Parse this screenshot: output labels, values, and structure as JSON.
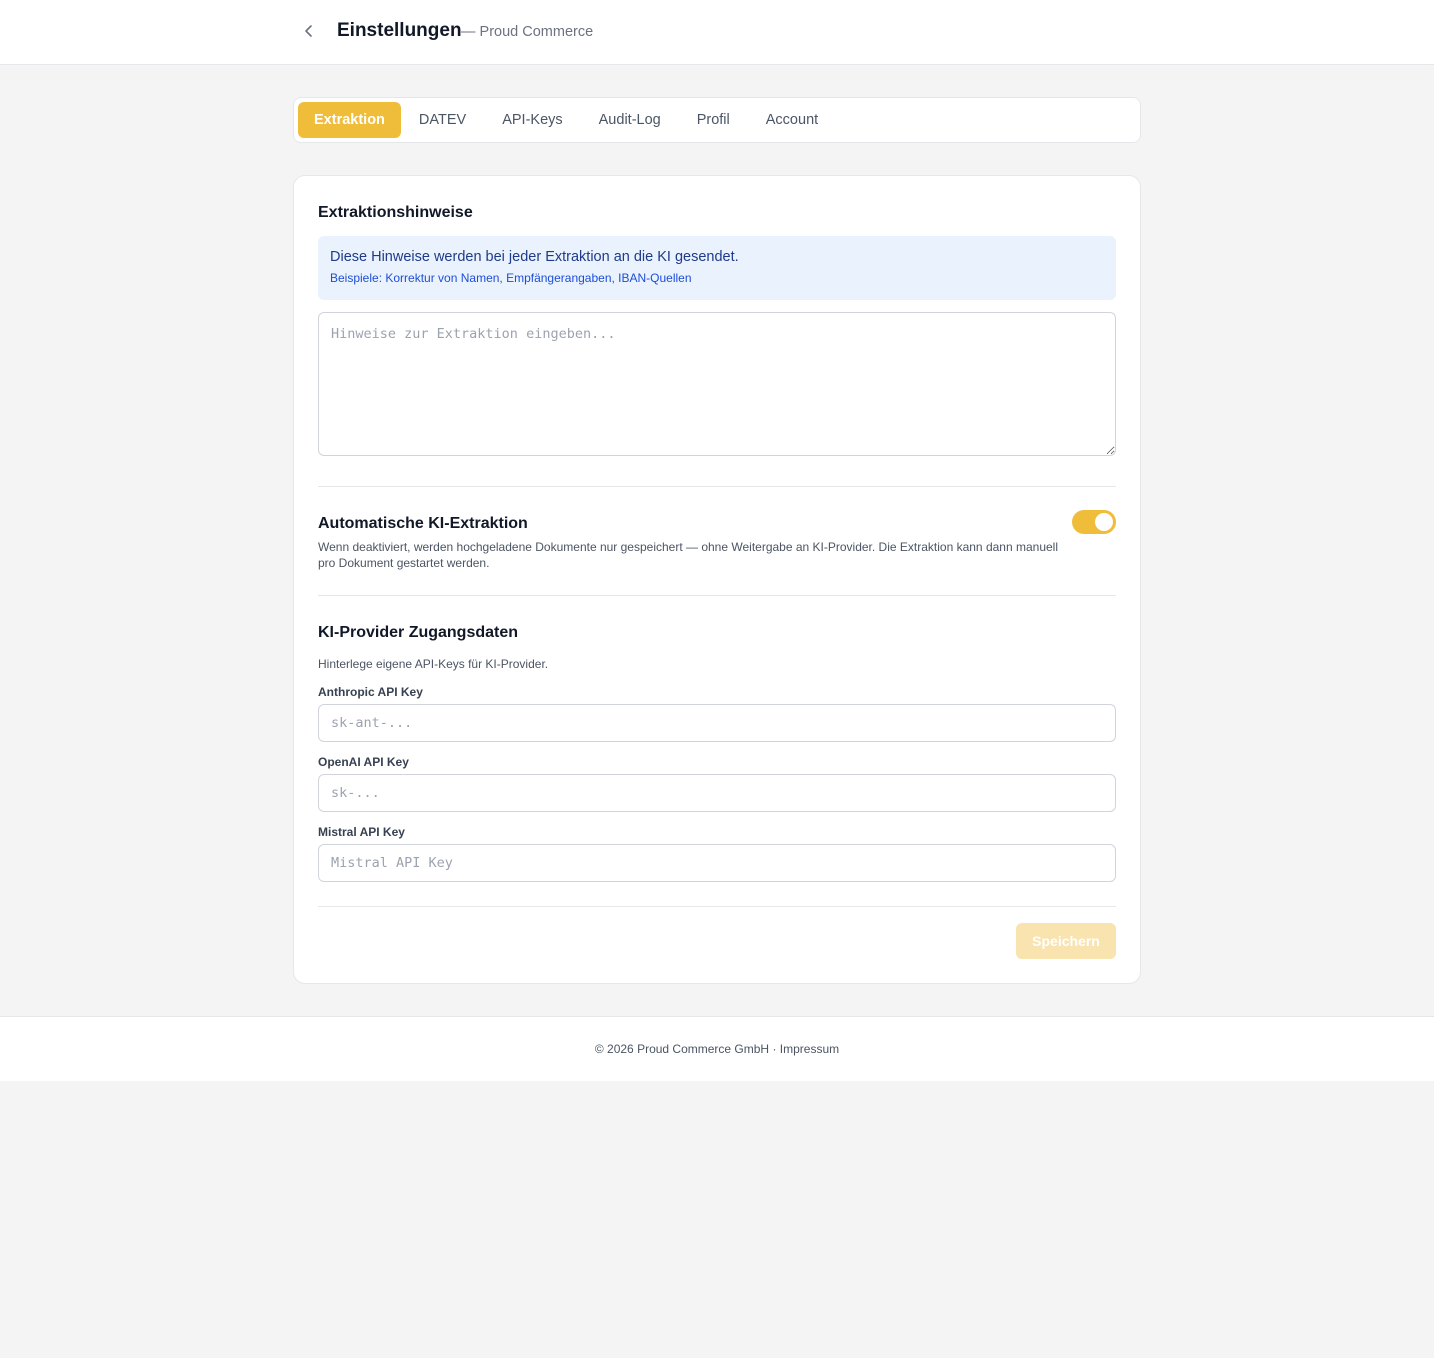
{
  "header": {
    "title": "Einstellungen",
    "subtitle": "— Proud Commerce"
  },
  "tabs": [
    {
      "label": "Extraktion",
      "active": true
    },
    {
      "label": "DATEV",
      "active": false
    },
    {
      "label": "API-Keys",
      "active": false
    },
    {
      "label": "Audit-Log",
      "active": false
    },
    {
      "label": "Profil",
      "active": false
    },
    {
      "label": "Account",
      "active": false
    }
  ],
  "hints_section": {
    "title": "Extraktionshinweise",
    "info_line1": "Diese Hinweise werden bei jeder Extraktion an die KI gesendet.",
    "info_line2": "Beispiele: Korrektur von Namen, Empfängerangaben, IBAN-Quellen",
    "textarea_placeholder": "Hinweise zur Extraktion eingeben...",
    "textarea_value": ""
  },
  "auto_extraction": {
    "title": "Automatische KI-Extraktion",
    "description": "Wenn deaktiviert, werden hochgeladene Dokumente nur gespeichert — ohne Weitergabe an KI-Provider. Die Extraktion kann dann manuell pro Dokument gestartet werden.",
    "enabled": true
  },
  "provider_section": {
    "title": "KI-Provider Zugangsdaten",
    "description": "Hinterlege eigene API-Keys für KI-Provider.",
    "fields": [
      {
        "label": "Anthropic API Key",
        "placeholder": "sk-ant-...",
        "value": ""
      },
      {
        "label": "OpenAI API Key",
        "placeholder": "sk-...",
        "value": ""
      },
      {
        "label": "Mistral API Key",
        "placeholder": "Mistral API Key",
        "value": ""
      }
    ]
  },
  "save_label": "Speichern",
  "footer": {
    "copyright": "© 2026 Proud Commerce GmbH",
    "separator": " · ",
    "impressum": "Impressum"
  },
  "colors": {
    "accent": "#f0bd3b",
    "accent_disabled": "#f9e3ae",
    "info_bg": "#eaf3fd",
    "info_text": "#1e3a8a"
  },
  "icons": {
    "back": "chevron-left-icon"
  }
}
